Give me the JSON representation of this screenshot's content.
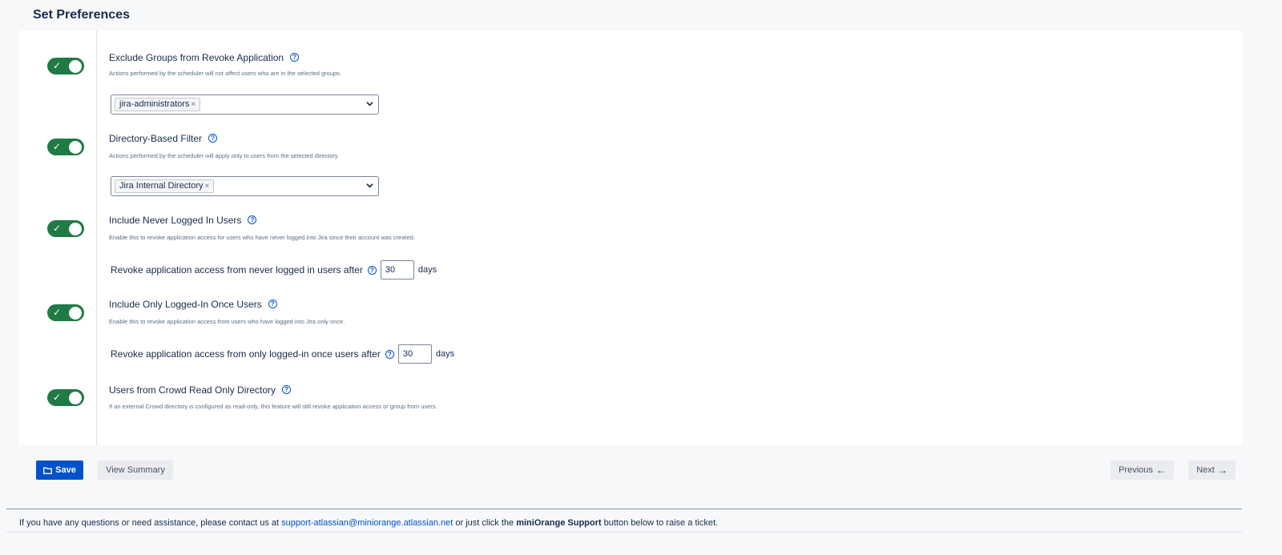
{
  "page_title": "Set Preferences",
  "options": [
    {
      "title": "Exclude Groups from Revoke Application",
      "description": "Actions performed by the scheduler will not affect users who are in the selected groups.",
      "enabled": true,
      "select_tag": "jira-administrators"
    },
    {
      "title": "Directory-Based Filter",
      "description": "Actions performed by the scheduler will apply only to users from the selected directory.",
      "enabled": true,
      "select_tag": "Jira Internal Directory"
    },
    {
      "title": "Include Never Logged In Users",
      "description": "Enable this to revoke application access for users who have never logged into Jira since their account was created.",
      "enabled": true,
      "days_label": "Revoke application access from never logged in users after",
      "days_value": "30",
      "days_unit": "days"
    },
    {
      "title": "Include Only Logged-In Once Users",
      "description": "Enable this to revoke application access from users who have logged into Jira only once.",
      "enabled": true,
      "days_label": "Revoke application access from only logged-in once users after",
      "days_value": "30",
      "days_unit": "days"
    },
    {
      "title": "Users from Crowd Read Only Directory",
      "description": "If an external Crowd directory is configured as read-only, this feature will still revoke application access or group from users.",
      "enabled": true
    }
  ],
  "buttons": {
    "save": "Save",
    "view_summary": "View Summary",
    "previous": "Previous",
    "next": "Next"
  },
  "icons": {
    "toggle_check": "check-icon",
    "help": "question-circle-icon",
    "tag_remove": "close-icon",
    "select_chevron": "chevron-down-icon",
    "save": "folder-icon",
    "previous": "arrow-left-icon",
    "next": "arrow-right-icon"
  },
  "footer": {
    "prefix": "If you have any questions or need assistance, please contact us at",
    "email": "support-atlassian@miniorange.atlassian.net",
    "middle": "or just click the",
    "bold": "miniOrange Support",
    "suffix": "button below to raise a ticket."
  },
  "colors": {
    "toggle_on": "#1f7a46",
    "primary": "#0052cc",
    "text": "#172b4d"
  }
}
